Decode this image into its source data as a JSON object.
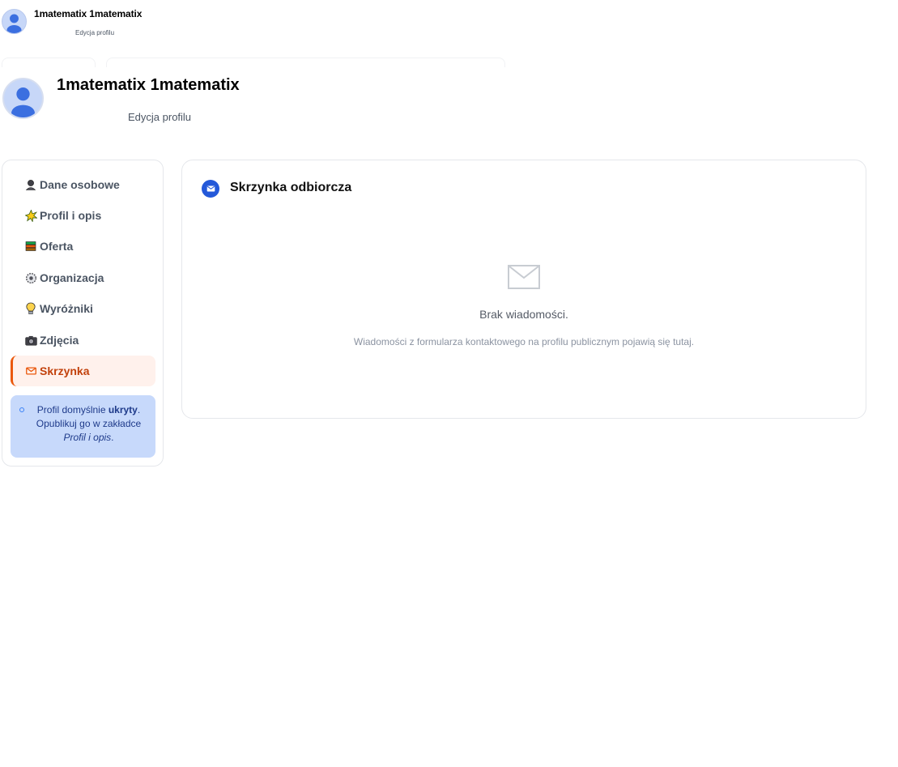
{
  "header": {
    "user_name": "1matematix 1matematix",
    "subtitle": "Edycja profilu"
  },
  "sidebar": {
    "items": [
      {
        "label": "Dane osobowe",
        "icon": "person-icon",
        "active": false
      },
      {
        "label": "Profil i opis",
        "icon": "sparkle-icon",
        "active": false
      },
      {
        "label": "Oferta",
        "icon": "books-icon",
        "active": false
      },
      {
        "label": "Organizacja",
        "icon": "gear-icon",
        "active": false
      },
      {
        "label": "Wyróżniki",
        "icon": "lightbulb-icon",
        "active": false
      },
      {
        "label": "Zdjęcia",
        "icon": "camera-icon",
        "active": false
      },
      {
        "label": "Skrzynka",
        "icon": "envelope-icon",
        "active": true
      }
    ],
    "info": {
      "text_before": "Profil domyślnie ",
      "text_bold": "ukryty",
      "text_after": ". Opublikuj go w zakładce ",
      "text_italic": "Profil i opis",
      "text_end": "."
    }
  },
  "inbox": {
    "title": "Skrzynka odbiorcza",
    "empty_title": "Brak wiadomości.",
    "empty_description": "Wiadomości z formularza kontaktowego na profilu publicznym pojawią się tutaj."
  },
  "colors": {
    "accent": "#ea580c",
    "active_bg": "#fff1ec",
    "active_text": "#c2410c",
    "primary_blue": "#2459d9",
    "info_bg": "#c7d9fb",
    "info_text": "#1e3a8a"
  }
}
